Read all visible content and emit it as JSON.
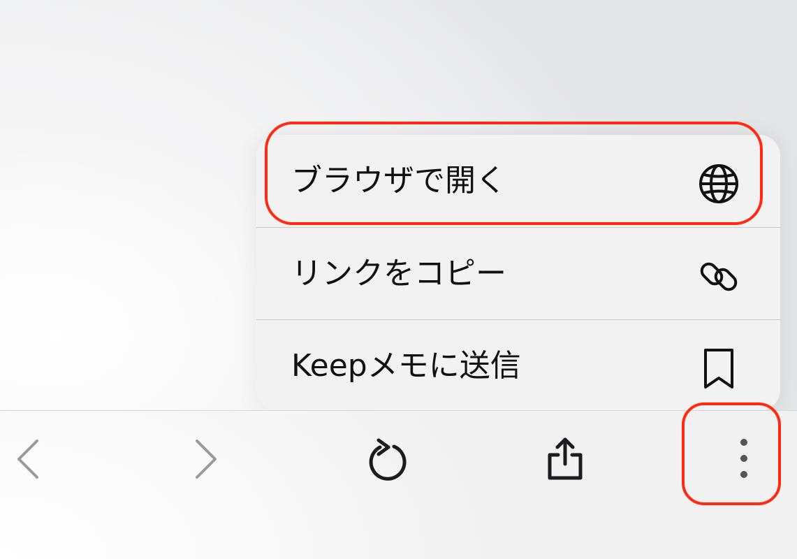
{
  "menu": {
    "items": [
      {
        "label": "ブラウザで開く",
        "icon": "globe-icon"
      },
      {
        "label": "リンクをコピー",
        "icon": "link-icon"
      },
      {
        "label": "Keepメモに送信",
        "icon": "bookmark-icon"
      }
    ]
  },
  "toolbar": {
    "buttons": [
      {
        "name": "back",
        "icon": "chevron-left-icon",
        "enabled": false
      },
      {
        "name": "forward",
        "icon": "chevron-right-icon",
        "enabled": false
      },
      {
        "name": "reload",
        "icon": "reload-icon",
        "enabled": true
      },
      {
        "name": "share",
        "icon": "share-icon",
        "enabled": true
      },
      {
        "name": "more",
        "icon": "more-vertical-icon",
        "enabled": true
      }
    ]
  },
  "colors": {
    "highlight": "#ff2a10",
    "menu_background": "#f2f2f3",
    "text": "#111111",
    "disabled_icon": "#9a9a9c",
    "icon": "#1c1c1e"
  }
}
